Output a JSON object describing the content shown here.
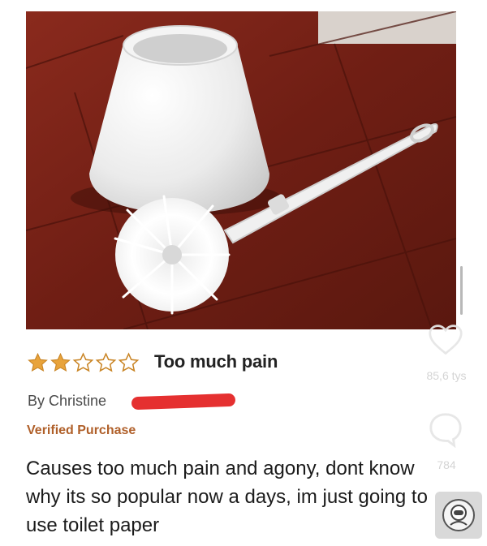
{
  "review": {
    "rating": 2,
    "rating_max": 5,
    "title": "Too much pain",
    "author_prefix": "By Christine",
    "verified_label": "Verified Purchase",
    "body": "Causes too much pain and agony, dont know why its so popular now a days, im just going to use toilet paper"
  },
  "product_image": {
    "subject": "white toilet brush with holder on red tiled floor"
  },
  "side_actions": {
    "like_count": "85,6 tys",
    "comment_count": "784",
    "like_icon": "heart-icon",
    "comment_icon": "comment-bubble-icon",
    "music_icon": "astronaut-disc-icon"
  },
  "colors": {
    "star_fill": "#e8a33b",
    "verified": "#b0602a",
    "redaction": "#e53030",
    "tile": "#7a2318"
  }
}
